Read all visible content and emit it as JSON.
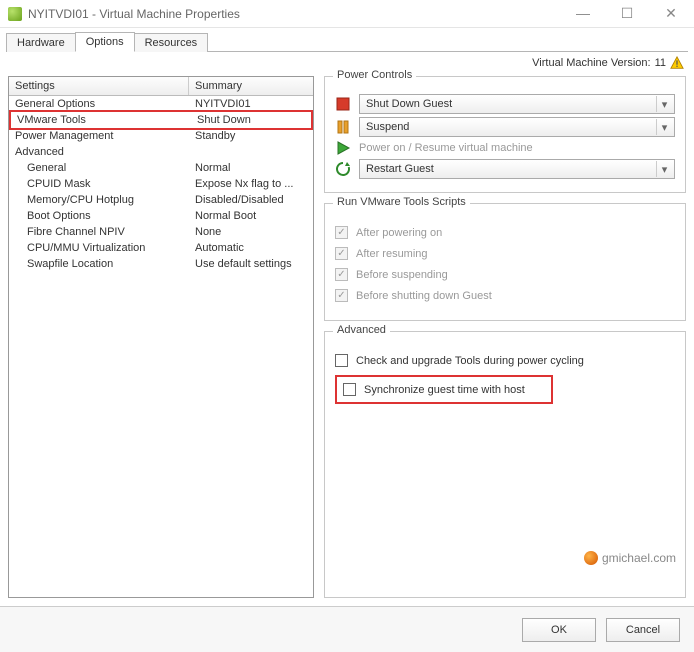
{
  "window": {
    "title": "NYITVDI01 - Virtual Machine Properties"
  },
  "version_label": "Virtual Machine Version:",
  "version_value": "11",
  "tabs": {
    "hardware": "Hardware",
    "options": "Options",
    "resources": "Resources"
  },
  "columns": {
    "settings": "Settings",
    "summary": "Summary"
  },
  "rows": [
    {
      "setting": "General Options",
      "summary": "NYITVDI01",
      "indent": false,
      "selected": false
    },
    {
      "setting": "VMware Tools",
      "summary": "Shut Down",
      "indent": false,
      "selected": true
    },
    {
      "setting": "Power Management",
      "summary": "Standby",
      "indent": false,
      "selected": false
    },
    {
      "setting": "Advanced",
      "summary": "",
      "indent": false,
      "selected": false
    },
    {
      "setting": "General",
      "summary": "Normal",
      "indent": true,
      "selected": false
    },
    {
      "setting": "CPUID Mask",
      "summary": "Expose Nx flag to ...",
      "indent": true,
      "selected": false
    },
    {
      "setting": "Memory/CPU Hotplug",
      "summary": "Disabled/Disabled",
      "indent": true,
      "selected": false
    },
    {
      "setting": "Boot Options",
      "summary": "Normal Boot",
      "indent": true,
      "selected": false
    },
    {
      "setting": "Fibre Channel NPIV",
      "summary": "None",
      "indent": true,
      "selected": false
    },
    {
      "setting": "CPU/MMU Virtualization",
      "summary": "Automatic",
      "indent": true,
      "selected": false
    },
    {
      "setting": "Swapfile Location",
      "summary": "Use default settings",
      "indent": true,
      "selected": false
    }
  ],
  "power_controls": {
    "legend": "Power Controls",
    "shutdown": "Shut Down Guest",
    "suspend": "Suspend",
    "poweron": "Power on / Resume virtual machine",
    "restart": "Restart Guest"
  },
  "scripts": {
    "legend": "Run VMware Tools Scripts",
    "after_power_on": "After powering on",
    "after_resuming": "After resuming",
    "before_suspending": "Before suspending",
    "before_shutdown": "Before shutting down Guest"
  },
  "advanced": {
    "legend": "Advanced",
    "check_upgrade": "Check and upgrade Tools during power cycling",
    "sync_time": "Synchronize guest time with host"
  },
  "buttons": {
    "ok": "OK",
    "cancel": "Cancel"
  },
  "watermark": "gmichael.com"
}
